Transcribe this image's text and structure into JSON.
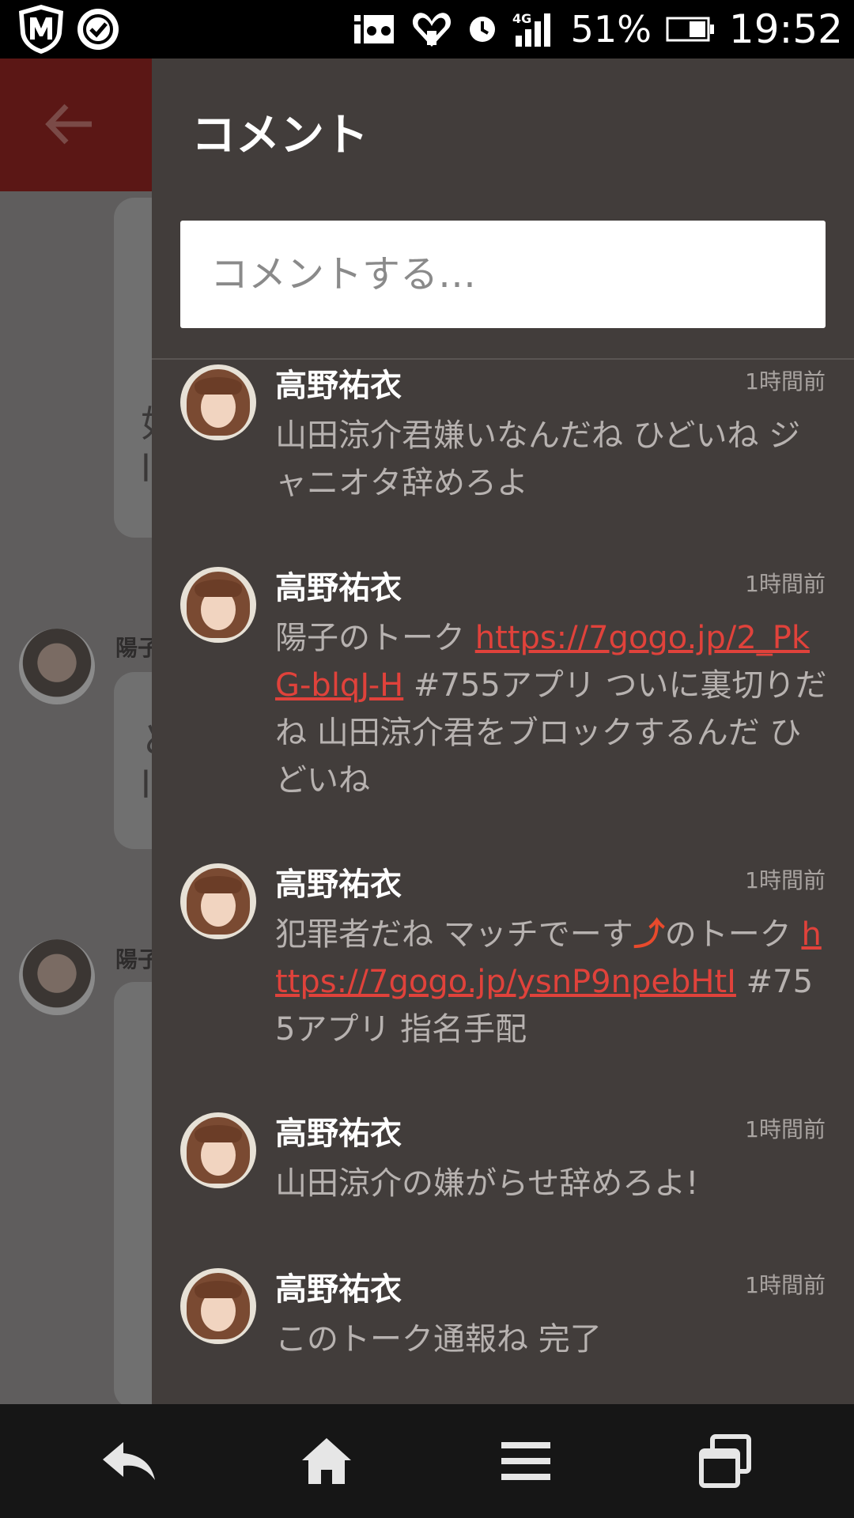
{
  "status_bar": {
    "battery": "51%",
    "time": "19:52",
    "network": "4G",
    "icons": [
      "m-shield-icon",
      "check-circle-icon",
      "video-icon",
      "heart-icon",
      "alarm-icon",
      "signal-icon",
      "battery-icon"
    ]
  },
  "background": {
    "names": [
      "陽子",
      "陽子"
    ]
  },
  "drawer": {
    "title": "コメント",
    "input_placeholder": "コメントする…"
  },
  "comments": [
    {
      "author": "高野祐衣",
      "time": "1時間前",
      "text": "山田涼介君嫌いなんだね ひどいね ジャニオタ辞めろよ"
    },
    {
      "author": "高野祐衣",
      "time": "1時間前",
      "text_before": "陽子のトーク ",
      "link": "https://7gogo.jp/2_PkG-blqJ-H",
      "text_after": " #755アプリ ついに裏切りだね 山田涼介君をブロックするんだ ひどいね"
    },
    {
      "author": "高野祐衣",
      "time": "1時間前",
      "text_before": "犯罪者だね マッチでーす",
      "arrow": "⤴",
      "text_mid": "のトーク ",
      "link": "https://7gogo.jp/ysnP9npebHtI",
      "text_after": " #755アプリ 指名手配"
    },
    {
      "author": "高野祐衣",
      "time": "1時間前",
      "text": "山田涼介の嫌がらせ辞めろよ!"
    },
    {
      "author": "高野祐衣",
      "time": "1時間前",
      "text": "このトーク通報ね 完了"
    }
  ],
  "colors": {
    "drawer_bg": "#423d3b",
    "header_red": "#5b1715",
    "link": "#e0423b",
    "nav_bg": "#161616"
  }
}
